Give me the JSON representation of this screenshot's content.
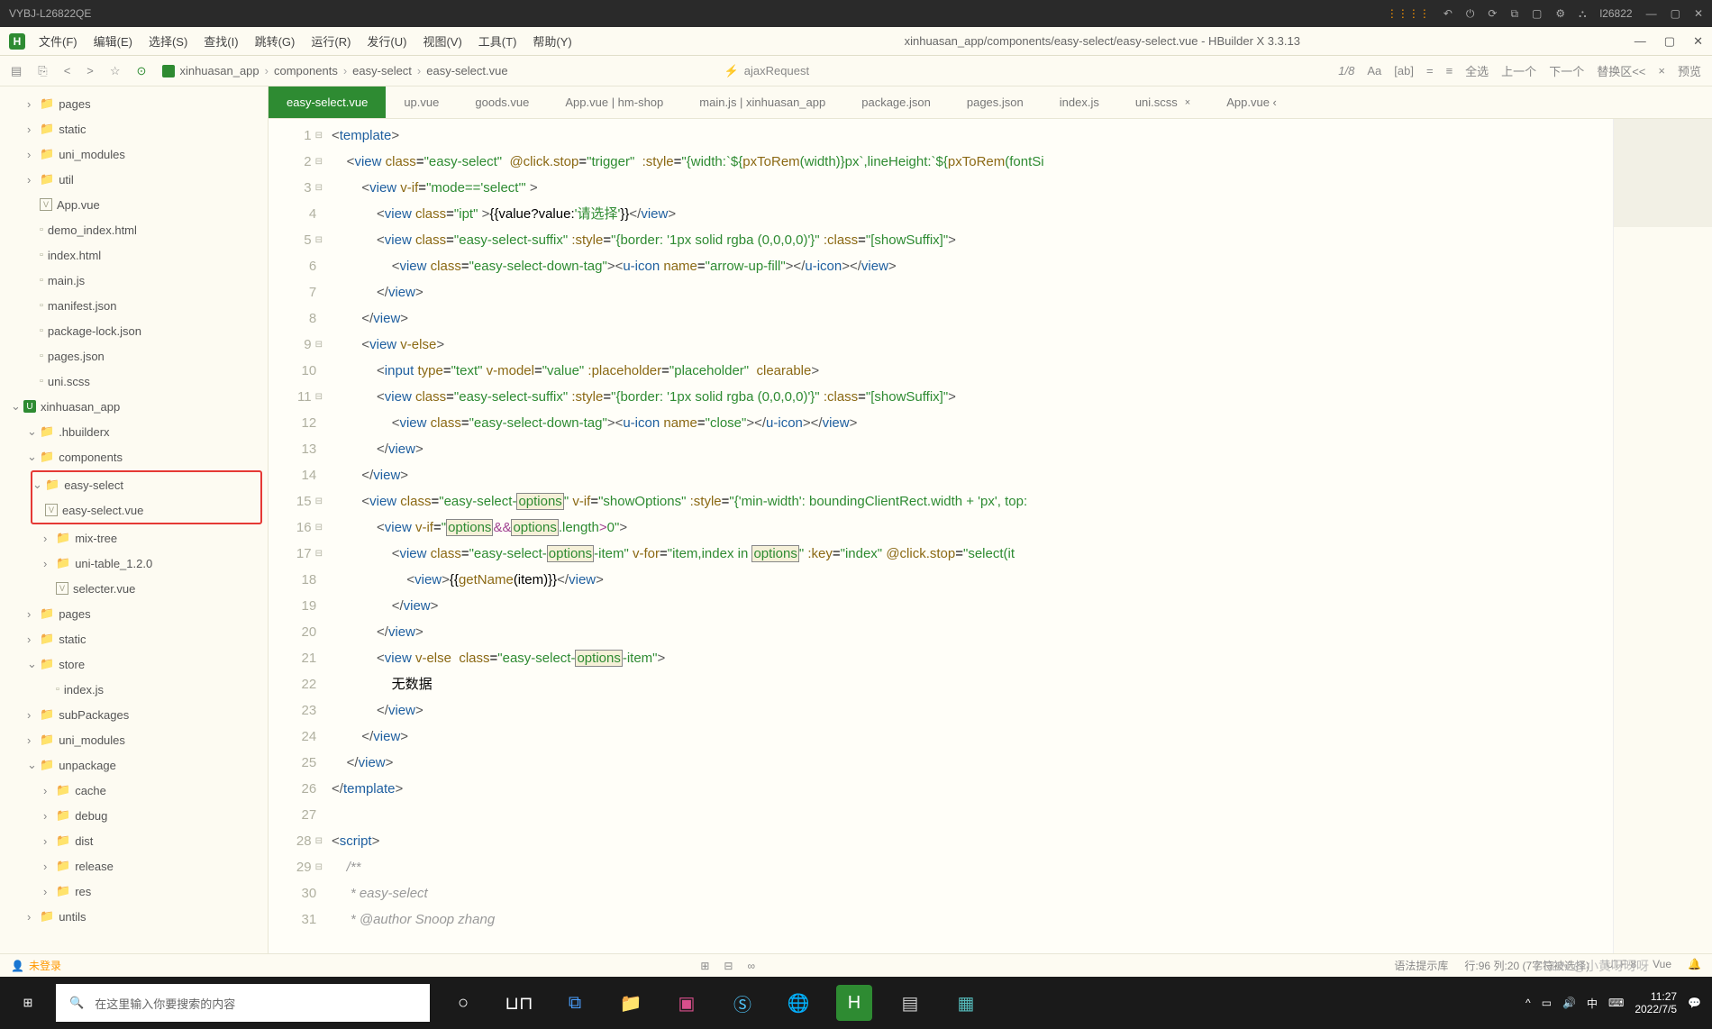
{
  "os": {
    "title": "VYBJ-L26822QE",
    "user": "l26822"
  },
  "menubar": {
    "items": [
      "文件(F)",
      "编辑(E)",
      "选择(S)",
      "查找(I)",
      "跳转(G)",
      "运行(R)",
      "发行(U)",
      "视图(V)",
      "工具(T)",
      "帮助(Y)"
    ],
    "app_title": "xinhuasan_app/components/easy-select/easy-select.vue - HBuilder X 3.3.13"
  },
  "toolbar": {
    "breadcrumb": [
      "xinhuasan_app",
      "components",
      "easy-select",
      "easy-select.vue"
    ],
    "func": "ajaxRequest",
    "counter": "1/8",
    "actions": [
      "Aa",
      "[ab]",
      "=",
      "≡",
      "全选",
      "上一个",
      "下一个",
      "替换区<<",
      "×",
      "预览"
    ]
  },
  "tree": [
    {
      "d": 1,
      "t": "folder",
      "n": "pages",
      "c": true
    },
    {
      "d": 1,
      "t": "folder",
      "n": "static",
      "c": true
    },
    {
      "d": 1,
      "t": "folder",
      "n": "uni_modules",
      "c": true
    },
    {
      "d": 1,
      "t": "folder",
      "n": "util",
      "c": true
    },
    {
      "d": 1,
      "t": "vue",
      "n": "App.vue"
    },
    {
      "d": 1,
      "t": "file",
      "n": "demo_index.html"
    },
    {
      "d": 1,
      "t": "file",
      "n": "index.html"
    },
    {
      "d": 1,
      "t": "file",
      "n": "main.js"
    },
    {
      "d": 1,
      "t": "file",
      "n": "manifest.json"
    },
    {
      "d": 1,
      "t": "file",
      "n": "package-lock.json"
    },
    {
      "d": 1,
      "t": "file",
      "n": "pages.json"
    },
    {
      "d": 1,
      "t": "file",
      "n": "uni.scss"
    },
    {
      "d": 0,
      "t": "project",
      "n": "xinhuasan_app",
      "c": false
    },
    {
      "d": 1,
      "t": "folder",
      "n": ".hbuilderx",
      "c": false
    },
    {
      "d": 1,
      "t": "folder",
      "n": "components",
      "c": false
    },
    {
      "d": 2,
      "t": "folder",
      "n": "easy-select",
      "c": false,
      "hl": true
    },
    {
      "d": 3,
      "t": "vue",
      "n": "easy-select.vue",
      "hl": true
    },
    {
      "d": 2,
      "t": "folder",
      "n": "mix-tree",
      "c": true
    },
    {
      "d": 2,
      "t": "folder",
      "n": "uni-table_1.2.0",
      "c": true
    },
    {
      "d": 2,
      "t": "vue",
      "n": "selecter.vue"
    },
    {
      "d": 1,
      "t": "folder",
      "n": "pages",
      "c": true
    },
    {
      "d": 1,
      "t": "folder",
      "n": "static",
      "c": true
    },
    {
      "d": 1,
      "t": "folder",
      "n": "store",
      "c": false
    },
    {
      "d": 2,
      "t": "file",
      "n": "index.js"
    },
    {
      "d": 1,
      "t": "folder",
      "n": "subPackages",
      "c": true
    },
    {
      "d": 1,
      "t": "folder",
      "n": "uni_modules",
      "c": true
    },
    {
      "d": 1,
      "t": "folder",
      "n": "unpackage",
      "c": false
    },
    {
      "d": 2,
      "t": "folder",
      "n": "cache",
      "c": true
    },
    {
      "d": 2,
      "t": "folder",
      "n": "debug",
      "c": true
    },
    {
      "d": 2,
      "t": "folder",
      "n": "dist",
      "c": true
    },
    {
      "d": 2,
      "t": "folder",
      "n": "release",
      "c": true
    },
    {
      "d": 2,
      "t": "folder",
      "n": "res",
      "c": true
    },
    {
      "d": 1,
      "t": "folder",
      "n": "untils",
      "c": true
    }
  ],
  "tabs": [
    {
      "label": "easy-select.vue",
      "active": true
    },
    {
      "label": "up.vue"
    },
    {
      "label": "goods.vue"
    },
    {
      "label": "App.vue | hm-shop"
    },
    {
      "label": "main.js | xinhuasan_app"
    },
    {
      "label": "package.json"
    },
    {
      "label": "pages.json"
    },
    {
      "label": "index.js"
    },
    {
      "label": "uni.scss",
      "close": true
    },
    {
      "label": "App.vue ‹"
    }
  ],
  "code_lines": 31,
  "status": {
    "login": "未登录",
    "syntax": "语法提示库",
    "cursor": "行:96  列:20 (7字符被选择)",
    "encoding": "UTF-8",
    "lang": "Vue"
  },
  "taskbar": {
    "search_placeholder": "在这里输入你要搜索的内容",
    "time": "11:27",
    "date": "2022/7/5"
  },
  "watermark": "CSDN @小黄呀呀呀"
}
